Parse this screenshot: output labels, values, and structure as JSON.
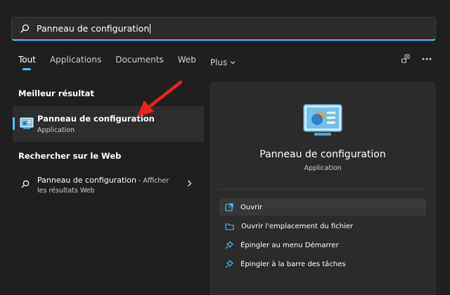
{
  "search": {
    "query": "Panneau de configuration"
  },
  "tabs": [
    {
      "label": "Tout"
    },
    {
      "label": "Applications"
    },
    {
      "label": "Documents"
    },
    {
      "label": "Web"
    },
    {
      "label": "Plus"
    }
  ],
  "best_result": {
    "heading": "Meilleur résultat",
    "name": "Panneau de configuration",
    "type": "Application"
  },
  "web": {
    "heading": "Rechercher sur le Web",
    "item_title": "Panneau de configuration",
    "item_suffix": " - Afficher",
    "item_line2": "les résultats Web"
  },
  "detail": {
    "title": "Panneau de configuration",
    "subtitle": "Application",
    "actions": [
      {
        "label": "Ouvrir",
        "icon": "open-icon"
      },
      {
        "label": "Ouvrir l'emplacement du fichier",
        "icon": "folder-icon"
      },
      {
        "label": "Épingler au menu Démarrer",
        "icon": "pin-icon"
      },
      {
        "label": "Épingler à la barre des tâches",
        "icon": "pin-icon"
      }
    ]
  },
  "colors": {
    "accent": "#4cc2ff",
    "background": "#1f1f1f",
    "panel": "#2b2b2b",
    "arrow": "#e8231f"
  }
}
